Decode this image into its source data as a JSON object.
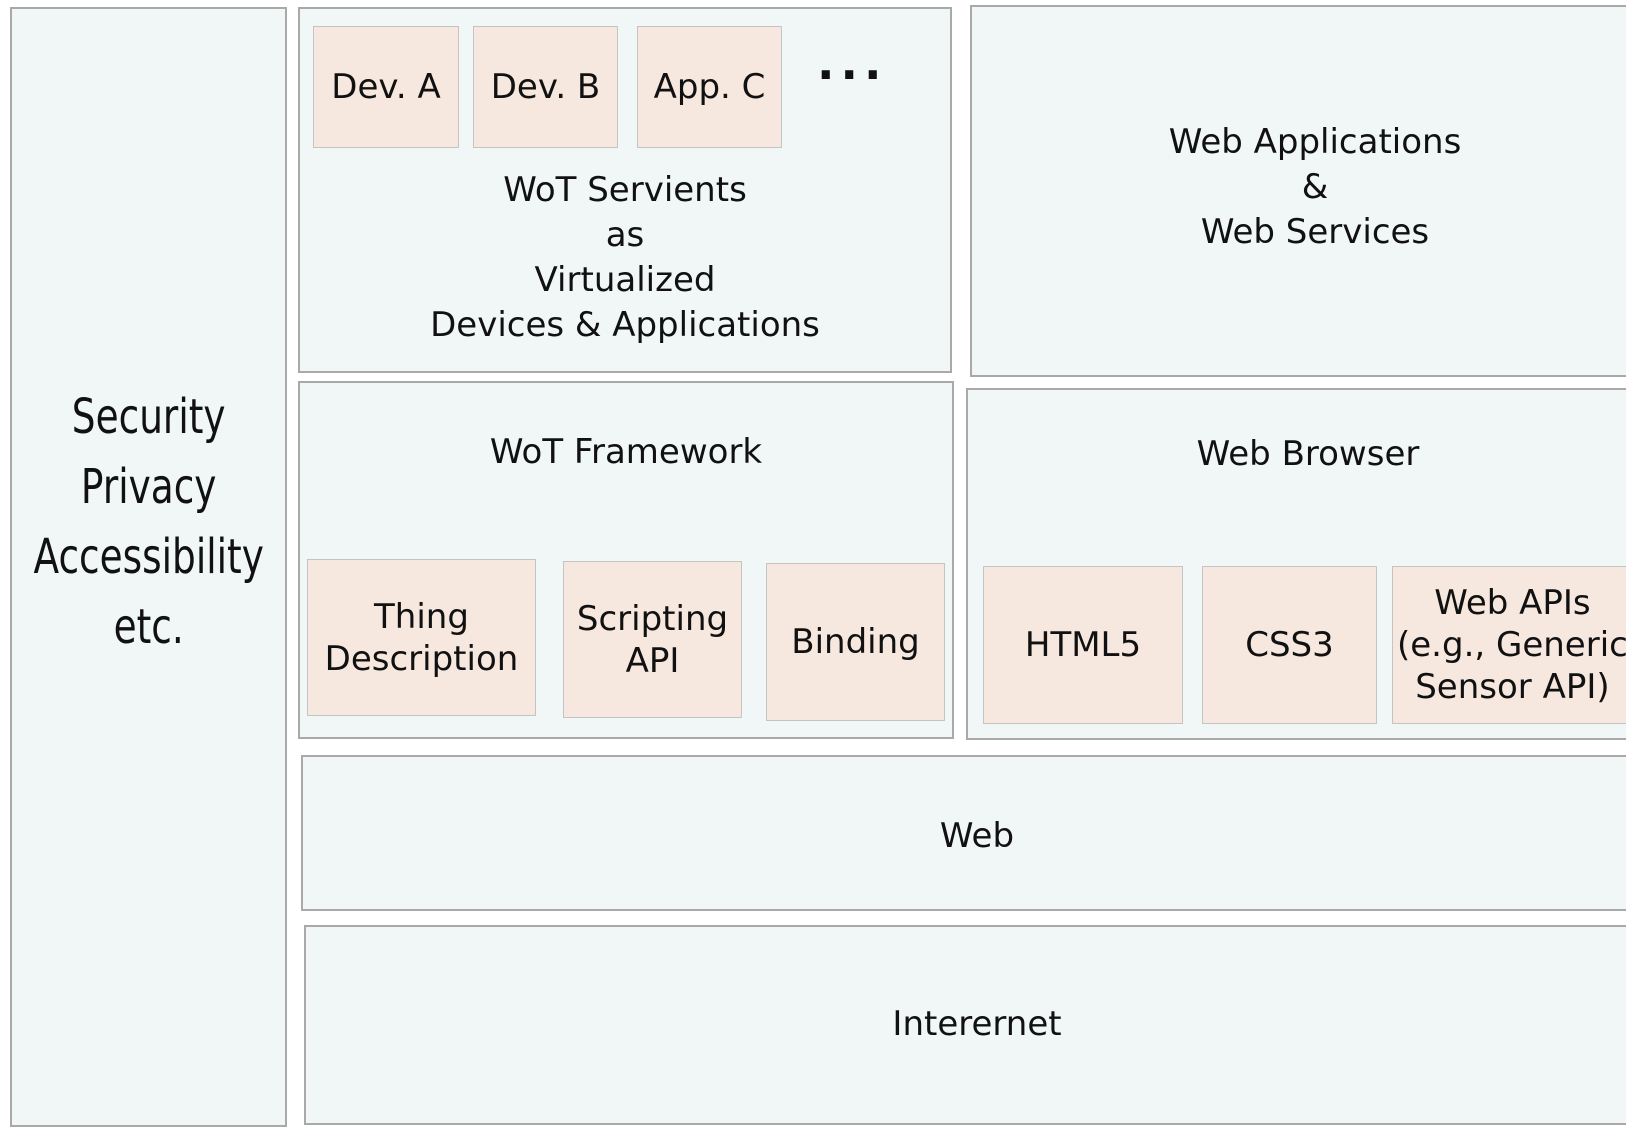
{
  "cross_cutting": {
    "label": "Security\nPrivacy\nAccessibility\netc."
  },
  "servients": {
    "label": "WoT Servients\nas\nVirtualized\nDevices & Applications",
    "items": [
      "Dev. A",
      "Dev. B",
      "App. C"
    ],
    "more": "..."
  },
  "web_apps": {
    "label": "Web Applications\n&\nWeb Services"
  },
  "wot_framework": {
    "label": "WoT Framework",
    "items": [
      "Thing\nDescription",
      "Scripting\nAPI",
      "Binding"
    ]
  },
  "web_browser": {
    "label": "Web Browser",
    "items": [
      "HTML5",
      "CSS3",
      "Web APIs\n(e.g., Generic\nSensor API)"
    ]
  },
  "web": {
    "label": "Web"
  },
  "internet": {
    "label": "Interernet"
  },
  "colors": {
    "layer_fill": "#f1f7f7",
    "component_fill": "#f6e7df",
    "border": "#a9a9a9"
  }
}
